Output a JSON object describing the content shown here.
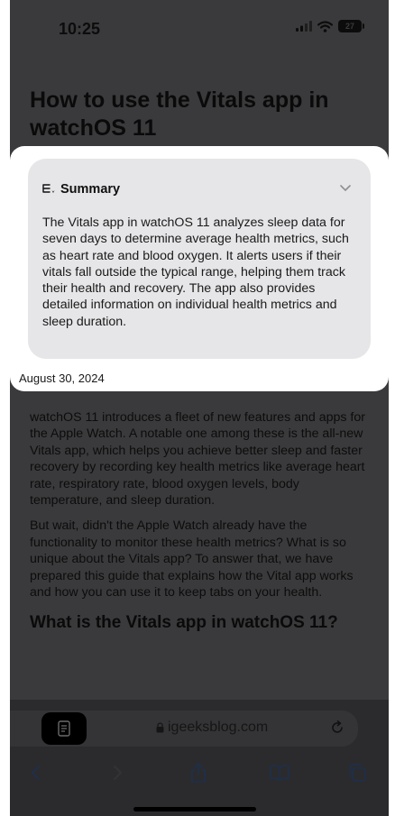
{
  "status_bar": {
    "time": "10:25",
    "battery": "27"
  },
  "article": {
    "title": "How to use the Vitals app in watchOS 11",
    "date": "August 30, 2024",
    "paragraphs": [
      "watchOS 11 introduces a fleet of new features and apps for the Apple Watch. A notable one among these is the all-new Vitals app, which helps you achieve better sleep and faster recovery by recording key health metrics like average heart rate, respiratory rate, blood oxygen levels, body temperature, and sleep duration.",
      "But wait, didn't the Apple Watch already have the functionality to monitor these health metrics? What is so unique about the Vitals app? To answer that, we have prepared this guide that explains how the Vital app works and how you can use it to keep tabs on your health."
    ],
    "subheading": "What is the Vitals app in watchOS 11?"
  },
  "summary": {
    "label": "Summary",
    "text": "The Vitals app in watchOS 11 analyzes sleep data for seven days to determine average health metrics, such as heart rate and blood oxygen. It alerts users if their vitals fall outside the typical range, helping them track their health and recovery. The app also provides detailed information on individual health metrics and sleep duration."
  },
  "browser": {
    "url": "igeeksblog.com"
  },
  "icons": {
    "summary": "summary-lines-icon",
    "chevron": "chevron-down-icon",
    "lock": "lock-icon",
    "reload": "reload-icon",
    "reader": "reader-mode-icon"
  },
  "colors": {
    "dim_overlay": "#3a3a3c",
    "card": "#ffffff",
    "summary_box": "#e6e6e8"
  }
}
